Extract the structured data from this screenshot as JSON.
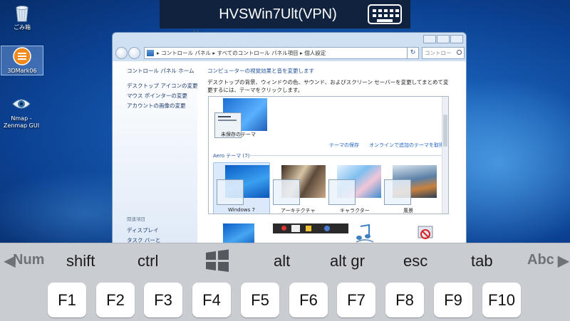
{
  "vpn_bar": {
    "title": "HVSWin7Ult(VPN)",
    "keyboard_icon": "keyboard-icon"
  },
  "desktop": {
    "icons": [
      {
        "label": "ごみ箱",
        "icon": "recycle-bin-icon"
      },
      {
        "label": "3DMark06",
        "icon": "3dmark-icon"
      },
      {
        "label": "Nmap - Zenmap GUI",
        "icon": "nmap-eye-icon"
      }
    ]
  },
  "window": {
    "address": {
      "crumb1": "コントロール パネル",
      "crumb2": "すべてのコントロール パネル項目",
      "crumb3": "個人設定",
      "search_placeholder": "コントロー"
    },
    "sidebar": {
      "home": "コントロール パネル ホーム",
      "links": [
        "デスクトップ アイコンの変更",
        "マウス ポインターの変更",
        "アカウントの画像の変更"
      ],
      "see_also_title": "関連項目",
      "see_also": [
        "ディスプレイ",
        "タスク バーと"
      ]
    },
    "main": {
      "heading": "コンピューターの視覚効果と音を変更します",
      "description": "デスクトップの背景、ウィンドウの色、サウンド、およびスクリーン セーバーを変更してまとめて変更するには、テーマをクリックします。",
      "unsaved_theme": "未保存のテーマ",
      "save_theme": "テーマの保存",
      "online_themes": "オンラインで追加のテーマを取得",
      "aero_section": "Aero テーマ (7)",
      "themes": [
        "Windows 7",
        "アーキテクチャ",
        "キャラクター",
        "風景"
      ]
    }
  },
  "keyboard": {
    "modifiers": [
      "Num",
      "shift",
      "ctrl",
      "alt",
      "alt gr",
      "esc",
      "tab",
      "Abc"
    ],
    "windows_key_icon": "windows-logo-icon",
    "function_keys": [
      "F1",
      "F2",
      "F3",
      "F4",
      "F5",
      "F6",
      "F7",
      "F8",
      "F9",
      "F10"
    ]
  }
}
